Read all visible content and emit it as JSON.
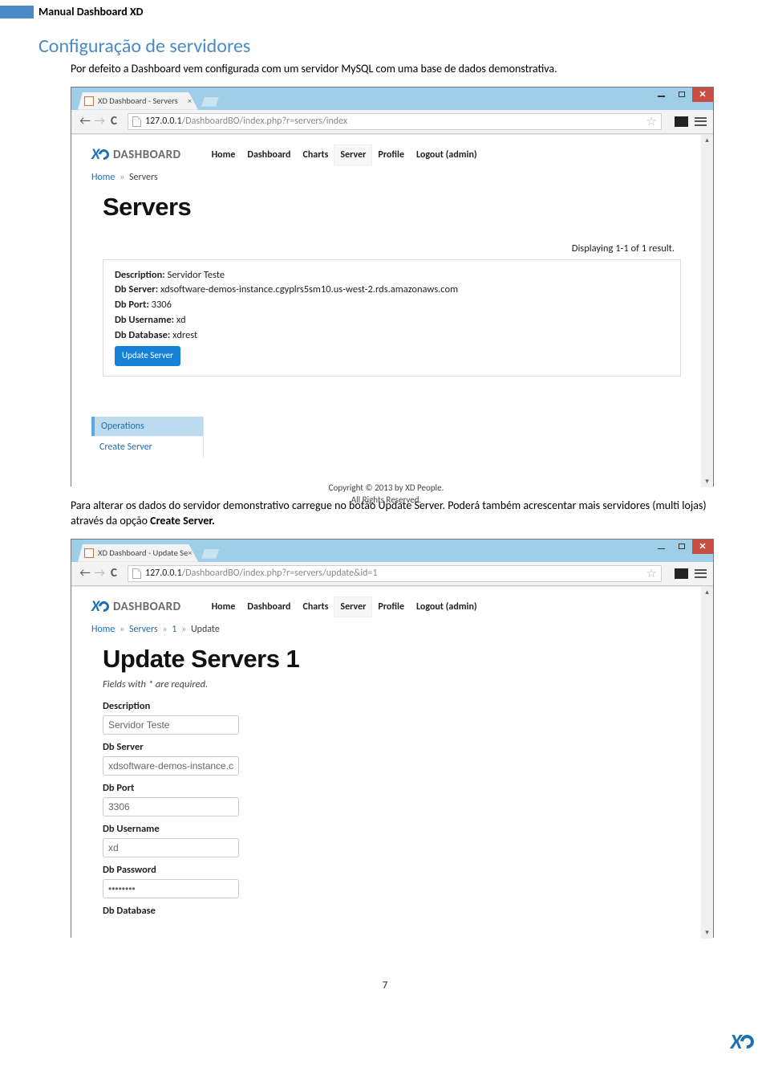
{
  "doc": {
    "header": "Manual Dashboard XD",
    "section_title": "Configuração de servidores",
    "intro": "Por defeito a Dashboard vem configurada com um servidor MySQL com uma base de dados demonstrativa.",
    "para2a": "Para alterar os dados do servidor demonstrativo carregue no botão Update Server. Poderá também acrescentar mais servidores (multi lojas) através da opção ",
    "para2b": "Create Server.",
    "page_number": "7"
  },
  "win1": {
    "tab_title": "XD Dashboard - Servers",
    "url_host": "127.0.0.1",
    "url_path": "/DashboardBO/index.php?r=servers/index",
    "nav": [
      "Home",
      "Dashboard",
      "Charts",
      "Server",
      "Profile",
      "Logout (admin)"
    ],
    "logo_text": "DASHBOARD",
    "breadcrumb": {
      "home": "Home",
      "cur": "Servers"
    },
    "h1": "Servers",
    "result_count": "Displaying 1-1 of 1 result.",
    "card": {
      "description_l": "Description:",
      "description_v": "Servidor Teste",
      "server_l": "Db Server:",
      "server_v": "xdsoftware-demos-instance.cgyplrs5sm10.us-west-2.rds.amazonaws.com",
      "port_l": "Db Port:",
      "port_v": "3306",
      "user_l": "Db Username:",
      "user_v": "xd",
      "db_l": "Db Database:",
      "db_v": "xdrest",
      "btn": "Update Server"
    },
    "side": {
      "header": "Operations",
      "item": "Create Server"
    },
    "footer1": "Copyright © 2013 by XD People.",
    "footer2": "All Rights Reserved."
  },
  "win2": {
    "tab_title": "XD Dashboard - Update Se",
    "url_host": "127.0.0.1",
    "url_path": "/DashboardBO/index.php?r=servers/update&id=1",
    "nav": [
      "Home",
      "Dashboard",
      "Charts",
      "Server",
      "Profile",
      "Logout (admin)"
    ],
    "logo_text": "DASHBOARD",
    "breadcrumb": {
      "home": "Home",
      "p2": "Servers",
      "p3": "1",
      "cur": "Update"
    },
    "h1": "Update Servers 1",
    "req_note": "Fields with * are required.",
    "fields": {
      "description_l": "Description",
      "description_v": "Servidor Teste",
      "server_l": "Db Server",
      "server_v": "xdsoftware-demos-instance.cgyp",
      "port_l": "Db Port",
      "port_v": "3306",
      "user_l": "Db Username",
      "user_v": "xd",
      "pass_l": "Db Password",
      "pass_v": "••••••••",
      "db_l": "Db Database"
    }
  }
}
